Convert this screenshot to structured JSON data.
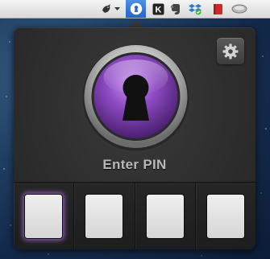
{
  "menubar": {
    "icons": [
      "bird-icon",
      "dropdown-arrow-icon",
      "onepassword-keyhole-icon",
      "k-box-icon",
      "evernote-icon",
      "dropbox-sync-icon",
      "red-book-icon",
      "drive-icon"
    ],
    "active_icon": "onepassword-keyhole-icon"
  },
  "panel": {
    "settings_icon": "gear-icon",
    "lock_icon": "keyhole-icon",
    "prompt": "Enter PIN",
    "pin_slots": [
      {
        "state": "active"
      },
      {
        "state": "empty"
      },
      {
        "state": "empty"
      },
      {
        "state": "empty"
      }
    ]
  },
  "colors": {
    "accent_purple": "#8e4bc4",
    "panel_background": "#2e2e2e",
    "menubar_highlight": "#2f6fd6"
  }
}
